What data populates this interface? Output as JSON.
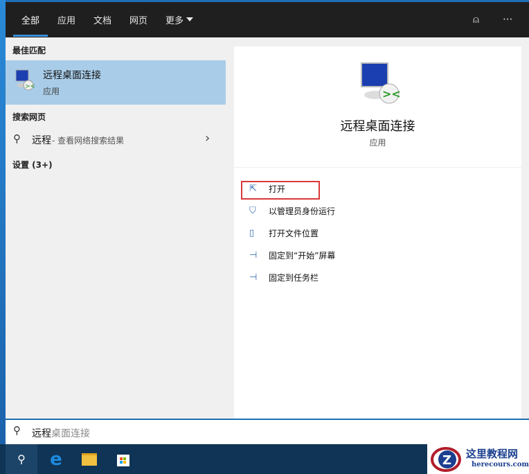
{
  "tabs": [
    {
      "label": "全部"
    },
    {
      "label": "应用"
    },
    {
      "label": "文档"
    },
    {
      "label": "网页"
    },
    {
      "label": "更多"
    }
  ],
  "left": {
    "best_header": "最佳匹配",
    "best": {
      "title": "远程桌面连接",
      "type": "应用"
    },
    "web_header": "搜索网页",
    "web": {
      "query": "远程",
      "hint": " - 查看网络搜索结果"
    },
    "settings_header": "设置 (3+)"
  },
  "detail": {
    "title": "远程桌面连接",
    "type": "应用",
    "actions": [
      {
        "label": "打开",
        "icon": "open-icon"
      },
      {
        "label": "以管理员身份运行",
        "icon": "shield-icon"
      },
      {
        "label": "打开文件位置",
        "icon": "file-icon"
      },
      {
        "label": "固定到“开始”屏幕",
        "icon": "pin-icon"
      },
      {
        "label": "固定到任务栏",
        "icon": "pin-icon"
      }
    ]
  },
  "search": {
    "typed": "远程",
    "suggest": "桌面连接"
  },
  "watermark": {
    "name": "这里教程网",
    "url": "herecours.com"
  }
}
